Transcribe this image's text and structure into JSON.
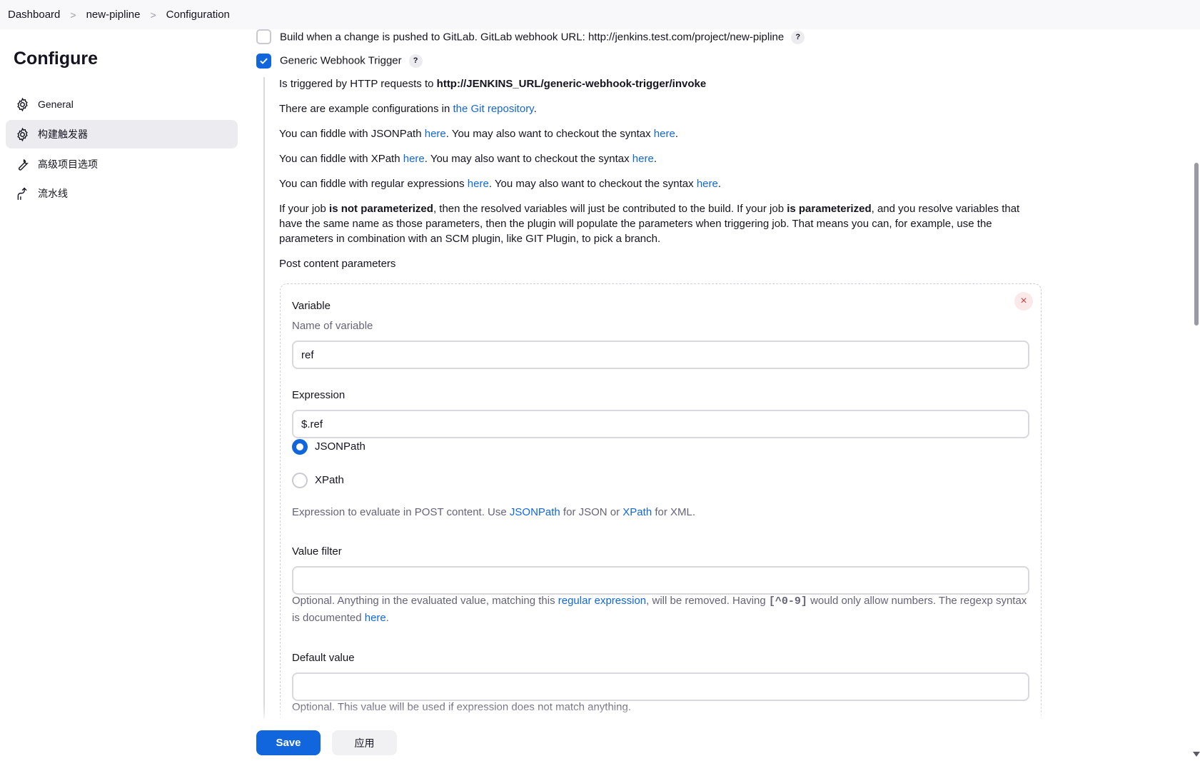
{
  "breadcrumb": {
    "items": [
      "Dashboard",
      "new-pipline",
      "Configuration"
    ],
    "separator": ">"
  },
  "sidebar": {
    "title": "Configure",
    "items": [
      {
        "label": "General",
        "icon": "gear-icon",
        "active": false
      },
      {
        "label": "构建触发器",
        "icon": "gear-icon",
        "active": true
      },
      {
        "label": "高级项目选项",
        "icon": "wrench-icon",
        "active": false
      },
      {
        "label": "流水线",
        "icon": "pipeline-icon",
        "active": false
      }
    ]
  },
  "triggers": {
    "gitlab": {
      "label": "Build when a change is pushed to GitLab. GitLab webhook URL: http://jenkins.test.com/project/new-pipline",
      "checked": false,
      "help": "?"
    },
    "generic": {
      "label": "Generic Webhook Trigger",
      "checked": true,
      "help": "?"
    }
  },
  "description": {
    "invoke_prefix": "Is triggered by HTTP requests to ",
    "invoke_url": "http://JENKINS_URL/generic-webhook-trigger/invoke",
    "examples_prefix": "There are example configurations in ",
    "examples_link": "the Git repository",
    "examples_suffix": ".",
    "jsonpath_prefix": "You can fiddle with JSONPath ",
    "xpath_prefix": "You can fiddle with XPath ",
    "regex_prefix": "You can fiddle with regular expressions ",
    "here": "here",
    "syntax_middle": ". You may also want to checkout the syntax ",
    "period": ".",
    "param_1": "If your job ",
    "param_bold_1": "is not parameterized",
    "param_2": ", then the resolved variables will just be contributed to the build. If your job ",
    "param_bold_2": "is parameterized",
    "param_3": ", and you resolve variables that have the same name as those parameters, then the plugin will populate the parameters when triggering job. That means you can, for example, use the parameters in combination with an SCM plugin, like GIT Plugin, to pick a branch.",
    "post_content_heading": "Post content parameters"
  },
  "parameter": {
    "close": "×",
    "variable_label": "Variable",
    "variable_desc": "Name of variable",
    "variable_value": "ref",
    "expression_label": "Expression",
    "expression_value": "$.ref",
    "radio_jsonpath": "JSONPath",
    "radio_xpath": "XPath",
    "selected": "JSONPath",
    "expr_desc_1": "Expression to evaluate in POST content. Use ",
    "expr_desc_link_1": "JSONPath",
    "expr_desc_2": " for JSON or ",
    "expr_desc_link_2": "XPath",
    "expr_desc_3": " for XML.",
    "value_filter_label": "Value filter",
    "value_filter_value": "",
    "vf_desc_1": "Optional. Anything in the evaluated value, matching this ",
    "vf_desc_link": "regular expression",
    "vf_desc_2": ", will be removed. Having ",
    "vf_desc_code": "[^0-9]",
    "vf_desc_3": " would only allow numbers. The regexp syntax is documented ",
    "vf_desc_link_2": "here",
    "vf_desc_4": ".",
    "default_label": "Default value",
    "default_value": "",
    "default_desc": "Optional. This value will be used if expression does not match anything."
  },
  "footer": {
    "save_label": "Save",
    "apply_label": "应用"
  },
  "colors": {
    "accent": "#1166dd",
    "link": "#1166dd",
    "muted_text": "#646478"
  }
}
